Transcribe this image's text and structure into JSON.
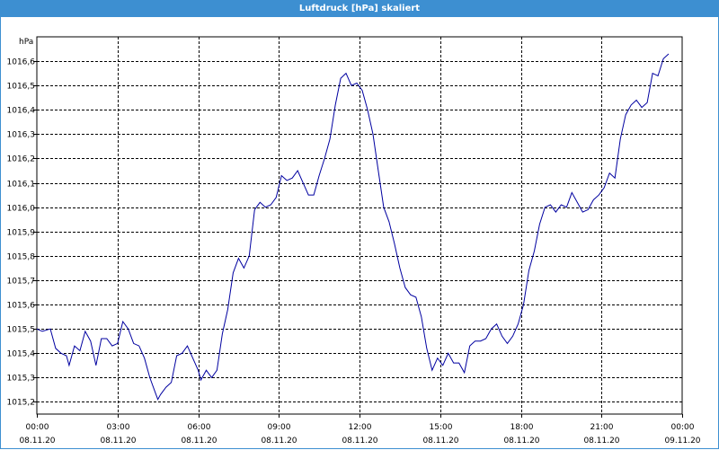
{
  "window": {
    "title": "Luftdruck [hPa] skaliert",
    "title_bg": "#3d8fd1"
  },
  "chart_data": {
    "type": "line",
    "title": "Luftdruck [hPa] skaliert",
    "ylabel": "hPa",
    "xlabel": "",
    "ylim": [
      1015.15,
      1016.7
    ],
    "yticks": [
      1015.2,
      1015.3,
      1015.4,
      1015.5,
      1015.6,
      1015.7,
      1015.8,
      1015.9,
      1016.0,
      1016.1,
      1016.2,
      1016.3,
      1016.4,
      1016.5,
      1016.6
    ],
    "ytick_labels": [
      "1015,2",
      "1015,3",
      "1015,4",
      "1015,5",
      "1015,6",
      "1015,7",
      "1015,8",
      "1015,9",
      "1016,0",
      "1016,1",
      "1016,2",
      "1016,3",
      "1016,4",
      "1016,5",
      "1016,6"
    ],
    "xlim_hours": [
      0,
      24
    ],
    "xticks": [
      {
        "hour": 0,
        "time": "00:00",
        "date": "08.11.20"
      },
      {
        "hour": 3,
        "time": "03:00",
        "date": "08.11.20"
      },
      {
        "hour": 6,
        "time": "06:00",
        "date": "08.11.20"
      },
      {
        "hour": 9,
        "time": "09:00",
        "date": "08.11.20"
      },
      {
        "hour": 12,
        "time": "12:00",
        "date": "08.11.20"
      },
      {
        "hour": 15,
        "time": "15:00",
        "date": "08.11.20"
      },
      {
        "hour": 18,
        "time": "18:00",
        "date": "08.11.20"
      },
      {
        "hour": 21,
        "time": "21:00",
        "date": "08.11.20"
      },
      {
        "hour": 24,
        "time": "00:00",
        "date": "09.11.20"
      }
    ],
    "grid": true,
    "line_color": "#0000a0",
    "series": [
      {
        "hours": [
          0.0,
          0.2,
          0.5,
          0.7,
          0.9,
          1.1,
          1.2,
          1.4,
          1.6,
          1.8,
          2.0,
          2.2,
          2.4,
          2.6,
          2.8,
          3.0,
          3.2,
          3.4,
          3.6,
          3.8,
          4.0,
          4.2,
          4.4,
          4.5,
          4.6,
          4.8,
          5.0,
          5.2,
          5.4,
          5.6,
          5.8,
          6.0,
          6.1,
          6.3,
          6.5,
          6.7,
          6.9,
          7.1,
          7.3,
          7.5,
          7.7,
          7.9,
          8.1,
          8.3,
          8.5,
          8.7,
          8.9,
          9.1,
          9.3,
          9.5,
          9.7,
          9.9,
          10.1,
          10.3,
          10.5,
          10.7,
          10.9,
          11.1,
          11.3,
          11.5,
          11.7,
          11.9,
          12.1,
          12.3,
          12.5,
          12.7,
          12.9,
          13.1,
          13.3,
          13.5,
          13.7,
          13.9,
          14.1,
          14.3,
          14.5,
          14.7,
          14.9,
          15.1,
          15.3,
          15.5,
          15.7,
          15.9,
          16.1,
          16.3,
          16.5,
          16.7,
          16.9,
          17.1,
          17.3,
          17.5,
          17.7,
          17.9,
          18.1,
          18.3,
          18.5,
          18.7,
          18.9,
          19.1,
          19.3,
          19.5,
          19.7,
          19.9,
          20.1,
          20.3,
          20.5,
          20.7,
          20.9,
          21.1,
          21.3,
          21.5,
          21.7,
          21.9,
          22.1,
          22.3,
          22.5,
          22.7,
          22.9,
          23.1,
          23.3,
          23.5,
          23.7,
          23.9
        ],
        "values": [
          1015.5,
          1015.49,
          1015.5,
          1015.42,
          1015.4,
          1015.39,
          1015.35,
          1015.43,
          1015.41,
          1015.49,
          1015.45,
          1015.35,
          1015.46,
          1015.46,
          1015.43,
          1015.44,
          1015.53,
          1015.5,
          1015.44,
          1015.43,
          1015.38,
          1015.3,
          1015.24,
          1015.21,
          1015.23,
          1015.26,
          1015.28,
          1015.39,
          1015.4,
          1015.43,
          1015.38,
          1015.33,
          1015.29,
          1015.33,
          1015.3,
          1015.33,
          1015.48,
          1015.58,
          1015.73,
          1015.79,
          1015.75,
          1015.8,
          1015.99,
          1016.02,
          1016.0,
          1016.01,
          1016.04,
          1016.13,
          1016.11,
          1016.12,
          1016.15,
          1016.1,
          1016.05,
          1016.05,
          1016.13,
          1016.2,
          1016.28,
          1016.42,
          1016.53,
          1016.55,
          1016.5,
          1016.51,
          1016.48,
          1016.4,
          1016.3,
          1016.15,
          1016.0,
          1015.94,
          1015.85,
          1015.75,
          1015.67,
          1015.64,
          1015.63,
          1015.55,
          1015.42,
          1015.33,
          1015.38,
          1015.35,
          1015.4,
          1015.36,
          1015.36,
          1015.32,
          1015.43,
          1015.45,
          1015.45,
          1015.46,
          1015.5,
          1015.52,
          1015.47,
          1015.44,
          1015.47,
          1015.52,
          1015.6,
          1015.74,
          1015.82,
          1015.93,
          1016.0,
          1016.01,
          1015.98,
          1016.01,
          1016.0,
          1016.06,
          1016.02,
          1015.98,
          1015.99,
          1016.03,
          1016.05,
          1016.08,
          1016.14,
          1016.12,
          1016.28,
          1016.38,
          1016.42,
          1016.44,
          1016.41,
          1016.43,
          1016.55,
          1016.54,
          1016.61,
          1016.63
        ]
      }
    ]
  }
}
